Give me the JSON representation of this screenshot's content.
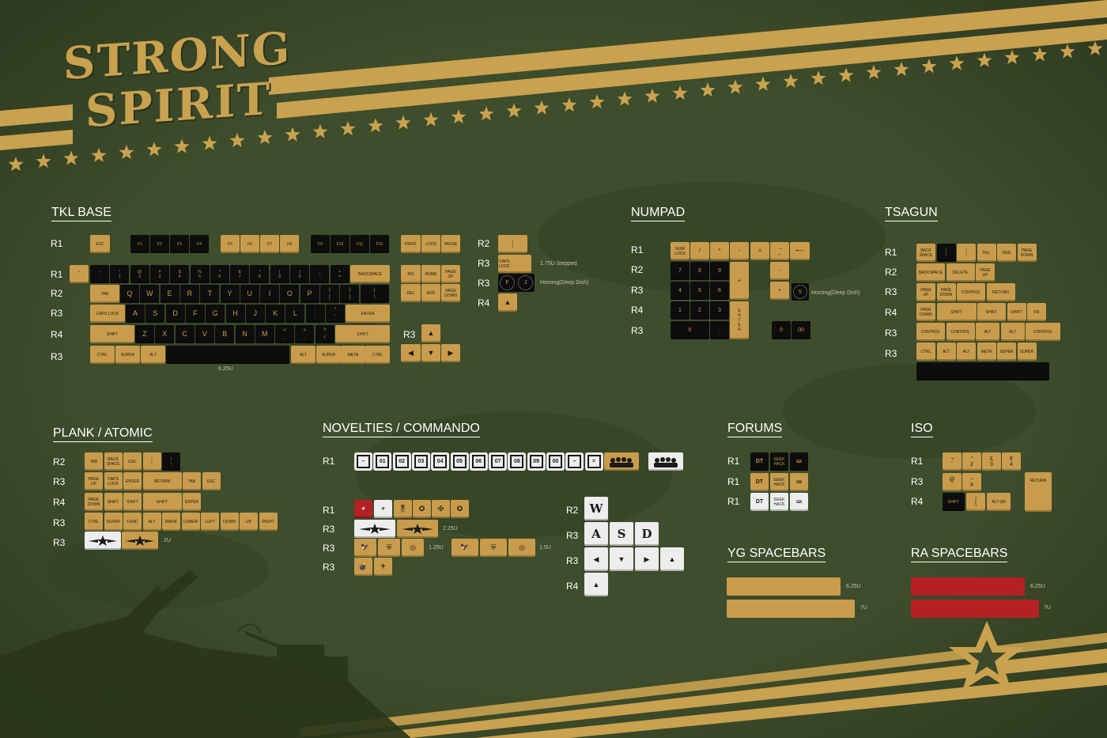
{
  "title": {
    "line1": "STRONG",
    "line2": "SPIRIT"
  },
  "colors": {
    "tan": "#c89c4c",
    "black": "#0d0d0d",
    "white": "#ededed",
    "red": "#b42125",
    "background": "#3c4a2a"
  },
  "sections": {
    "tkl": "TKL BASE",
    "numpad": "NUMPAD",
    "tsagun": "TSAGUN",
    "plank": "PLANK / ATOMIC",
    "novelties": "NOVELTIES / COMMANDO",
    "forums": "FORUMS",
    "iso": "ISO",
    "yg": "YG  SPACEBARS",
    "ra": "RA  SPACEBARS"
  },
  "rows": {
    "r1": "R1",
    "r2": "R2",
    "r3": "R3",
    "r4": "R4"
  },
  "notes": {
    "u625": "6.25U",
    "u175": "1.75U  Stepped",
    "homing": "Homing(Deep Dish)",
    "u225": "2.25U",
    "u2": "2U",
    "u125": "1.25U",
    "u15": "1.5U",
    "u7": "7U"
  },
  "tkl_keys": {
    "esc": "ESC",
    "f": [
      "F1",
      "F2",
      "F3",
      "F4",
      "F5",
      "F6",
      "F7",
      "F8",
      "F9",
      "F10",
      "F11",
      "F12"
    ],
    "print": "PRINT",
    "lock": "LOCK",
    "pause": "PAUSE",
    "num": [
      "~\n`",
      "!\n1",
      "@\n2",
      "#\n3",
      "$\n4",
      "%\n5",
      "^\n6",
      "&\n7",
      "*\n8",
      "(\n9",
      ")\n0",
      "_\n-",
      "+\n="
    ],
    "tilde_alt": "~\n`",
    "backspace": "BACKSPACE",
    "ins": "INS",
    "home": "HOME",
    "pageup": "PAGE\nUP",
    "tab": "TAB",
    "qrow": [
      "Q",
      "W",
      "E",
      "R",
      "T",
      "Y",
      "U",
      "I",
      "O",
      "P",
      "{\n[",
      "}\n]",
      "|\n\\"
    ],
    "del": "DEL",
    "end": "END",
    "pagedown": "PAGE\nDOWN",
    "caps": "CAPS LOCK",
    "arow": [
      "A",
      "S",
      "D",
      "F",
      "G",
      "H",
      "J",
      "K",
      "L",
      ":\n;",
      "\"\n'"
    ],
    "enter": "ENTER",
    "shift": "SHIFT",
    "zrow": [
      "Z",
      "X",
      "C",
      "V",
      "B",
      "N",
      "M",
      "<\n,",
      ">\n.",
      "?\n/"
    ],
    "ctrl": "CTRL",
    "super": "SUPER",
    "alt": "ALT",
    "meta": "META"
  },
  "tkl_side": {
    "pipe": "|\n\\",
    "caps": "CAPS\nLOCK",
    "f": "F",
    "j": "J"
  },
  "numpad_keys": {
    "r1": [
      "NUM\nLOCK",
      "/",
      "*",
      "-",
      "=",
      "→\n←",
      "⟵"
    ],
    "r2": [
      "7",
      "8",
      "9",
      "+",
      "-"
    ],
    "r3": [
      "4",
      "5",
      "6",
      "+",
      "5"
    ],
    "r4": [
      "1",
      "2",
      "3",
      "E\nN\nT\nE\nR"
    ],
    "r5": [
      "0",
      ".",
      "0",
      "00"
    ]
  },
  "tsagun_keys": {
    "r1": [
      "BACK\nSPACE",
      "|\n\\",
      "|\n\\",
      "DEL",
      "END",
      "PAGE\nDOWN"
    ],
    "r2": [
      "BACKSPACE",
      "DELETE",
      "PAGE\nUP"
    ],
    "r3": [
      "PAGE\nUP",
      "PAGE\nDOWN",
      "CONTROL",
      "RETURN"
    ],
    "r4": [
      "PAGE\nDOWN",
      "SHIFT",
      "SHIFT",
      "SHIFT",
      "FN"
    ],
    "r5": [
      "CONTROL",
      "CONTROL",
      "ALT",
      "ALT",
      "CONTROL"
    ],
    "r6": [
      "CTRL",
      "ALT",
      "ALT",
      "META",
      "SUPER",
      "SUPER"
    ]
  },
  "plank_keys": {
    "r2": [
      "TAB",
      "BACK\nSPACE",
      "ESC",
      "|\n\\",
      "|\n\\"
    ],
    "r3": [
      "PAGE\nUP",
      "CAPS\nLOCK",
      "ENTER",
      "RETURN",
      "TAB",
      "ESC"
    ],
    "r4": [
      "PAGE\nDOWN",
      "SHIFT",
      "SHIFT",
      "SHIFT",
      "ENTER"
    ],
    "r3b": [
      "CTRL",
      "SUPER",
      "FUNC",
      "ALT",
      "RAISE",
      "LOWER",
      "LEFT",
      "DOWN",
      "UP",
      "RIGHT"
    ]
  },
  "novelty_keys": {
    "numbers": [
      "–",
      "01",
      "02",
      "03",
      "04",
      "05",
      "06",
      "07",
      "08",
      "09",
      "00",
      "–",
      "="
    ],
    "wasd": [
      "W",
      "A",
      "S",
      "D"
    ],
    "arrows": [
      "◀",
      "▼",
      "▶",
      "▲",
      "▲"
    ]
  },
  "forum_keys": {
    "dt": "DT",
    "gh": "GEEK\nHACK",
    "kb": "KEYBOARD"
  },
  "iso_keys": {
    "r1": [
      "¬\n`",
      "\"\n2",
      "£\n3",
      "€\n4"
    ],
    "r3": [
      "@\n'",
      "~\n#",
      "RETURN"
    ],
    "r4": [
      "SHIFT",
      "|\n\\",
      "ALT GR"
    ]
  }
}
